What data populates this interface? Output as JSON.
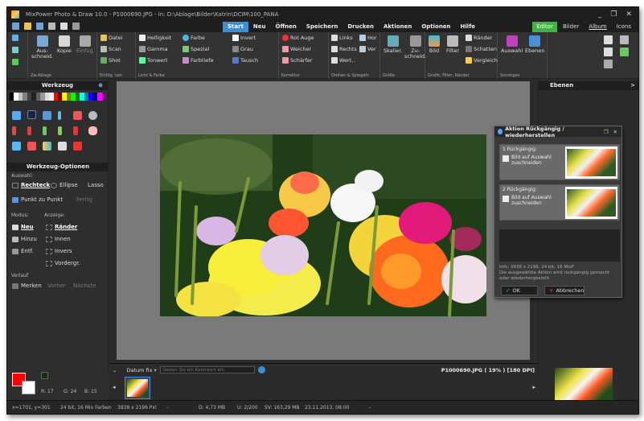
{
  "window": {
    "title": "MixPower Photo & Draw 10.0  -  P1000690.JPG  -  in: D:\\Ablage\\Bilder\\Katrin\\DCIM\\100_PANA",
    "controls": [
      "_",
      "❐",
      "✕"
    ]
  },
  "menubar": {
    "menus": [
      "Start",
      "Neu",
      "Öffnen",
      "Speichern",
      "Drucken",
      "Aktionen",
      "Optionen",
      "Hilfe"
    ],
    "active_menu": "Start",
    "modes": [
      "Editor",
      "Bilder",
      "Album",
      "Icons"
    ],
    "active_mode": "Editor"
  },
  "ribbon": {
    "groups": {
      "zwischenablage": {
        "label": "Zw.Ablage",
        "ausschneiden": "Aus-\nschneid.",
        "kopie": "Kopie",
        "einfuegen": "Einfüg."
      },
      "einfuegen_von": {
        "label": "Einfüg. von",
        "datei": "Datei",
        "scan": "Scan",
        "shot": "Shot"
      },
      "licht_farbe": {
        "label": "Licht & Farbe",
        "helligkeit": "Helligkeit",
        "gamma": "Gamma",
        "tonwert": "Tonwert",
        "farbe": "Farbe",
        "spezial": "Spezial",
        "farbtiefe": "Farbtiefe",
        "invert": "Invert",
        "grau": "Grau",
        "tausch": "Tausch"
      },
      "korrektur": {
        "label": "Korrektur",
        "rotauge": "Rot Auge",
        "weicher": "Weicher",
        "schaerfer": "Schärfer"
      },
      "drehen": {
        "label": "Drehen & Spiegeln",
        "links": "Links",
        "rechts": "Rechts",
        "wert": "Wert..",
        "hor": "Hor",
        "ver": "Ver"
      },
      "groesse": {
        "label": "Größe",
        "skalier": "Skalier.",
        "zuschneid": "Zu-\nschneid."
      },
      "grafik": {
        "label": "Grafik, Filter, Ränder",
        "bild": "Bild",
        "filter": "Filter",
        "raender": "Ränder",
        "schatten": "Schatten",
        "vergleich": "Vergleich"
      },
      "sonstiges": {
        "label": "Sonstiges",
        "auswahl": "Auswahl",
        "ebenen": "Ebenen"
      }
    }
  },
  "werkzeug": {
    "title": "Werkzeug",
    "palette": [
      "#000000",
      "#ffffff",
      "#c0c0c0",
      "#808080",
      "#404040",
      "#202020",
      "#606060",
      "#9a9a9a",
      "#dcdcdc",
      "#f0f0f0",
      "#ff0000",
      "#800000",
      "#ffff00",
      "#808000",
      "#00ff00",
      "#008000",
      "#00ffff",
      "#008080",
      "#0000ff",
      "#000080",
      "#ff00ff",
      "#800080"
    ],
    "options_title": "Werkzeug-Optionen",
    "auswahl_label": "Auswahl:",
    "rechteck": "Rechteck",
    "ellipse": "Ellipse",
    "lasso": "Lasso",
    "punkt": "Punkt zu Punkt",
    "fertig": "Fertig",
    "modus_label": "Modus:",
    "anzeige_label": "Anzeige:",
    "neu": "Neu",
    "hinzu": "Hinzu",
    "entf": "Entf.",
    "raender": "Ränder",
    "innen": "Innen",
    "invers": "Invers",
    "vordergr": "Vordergr.",
    "verlauf_label": "Verlauf",
    "merken": "Merken",
    "vorher": "Vorher",
    "naechste": "Nächste"
  },
  "colors": {
    "primary": "#ff0000",
    "secondary": "#ffffff",
    "r": "R: 17",
    "g": "G: 24",
    "b": "B: 15",
    "accent": "#3b8fd9",
    "editor_green": "#3fb33f"
  },
  "ebenen": {
    "title": "Ebenen"
  },
  "dialog": {
    "title": "Aktion Rückgängig / wiederherstellen",
    "steps": [
      {
        "label": "1 Rückgängig:",
        "desc": "Bild auf Auswahl\nzuschneiden"
      },
      {
        "label": "2 Rückgängig:",
        "desc": "Bild auf Auswahl\nzuschneiden"
      }
    ],
    "info": "Info: 3838 x 2196, 24 bit, 16 MioF\nDie ausgewählte Aktion wird rückgängig gemacht oder wiederhergestellt",
    "ok": "OK",
    "cancel": "Abbrechen"
  },
  "filmstrip": {
    "sort": "Datum fix",
    "search_placeholder": "Geben Sie ein Kennwort ein",
    "file_info": "P1000690.JPG  ( 19% )  [180 DPI]"
  },
  "status": {
    "coords": "x=1701, y=301",
    "depth": "24 bit, 16 Mio Farben",
    "size": "3838 x 2196 Pxl",
    "dash1": "-",
    "disk": "D: 4,73 MB",
    "undo": "U: 2/200",
    "sv": "SV: 163,29 MB",
    "date": "23.11.2013, 08:00",
    "dash2": "-"
  }
}
